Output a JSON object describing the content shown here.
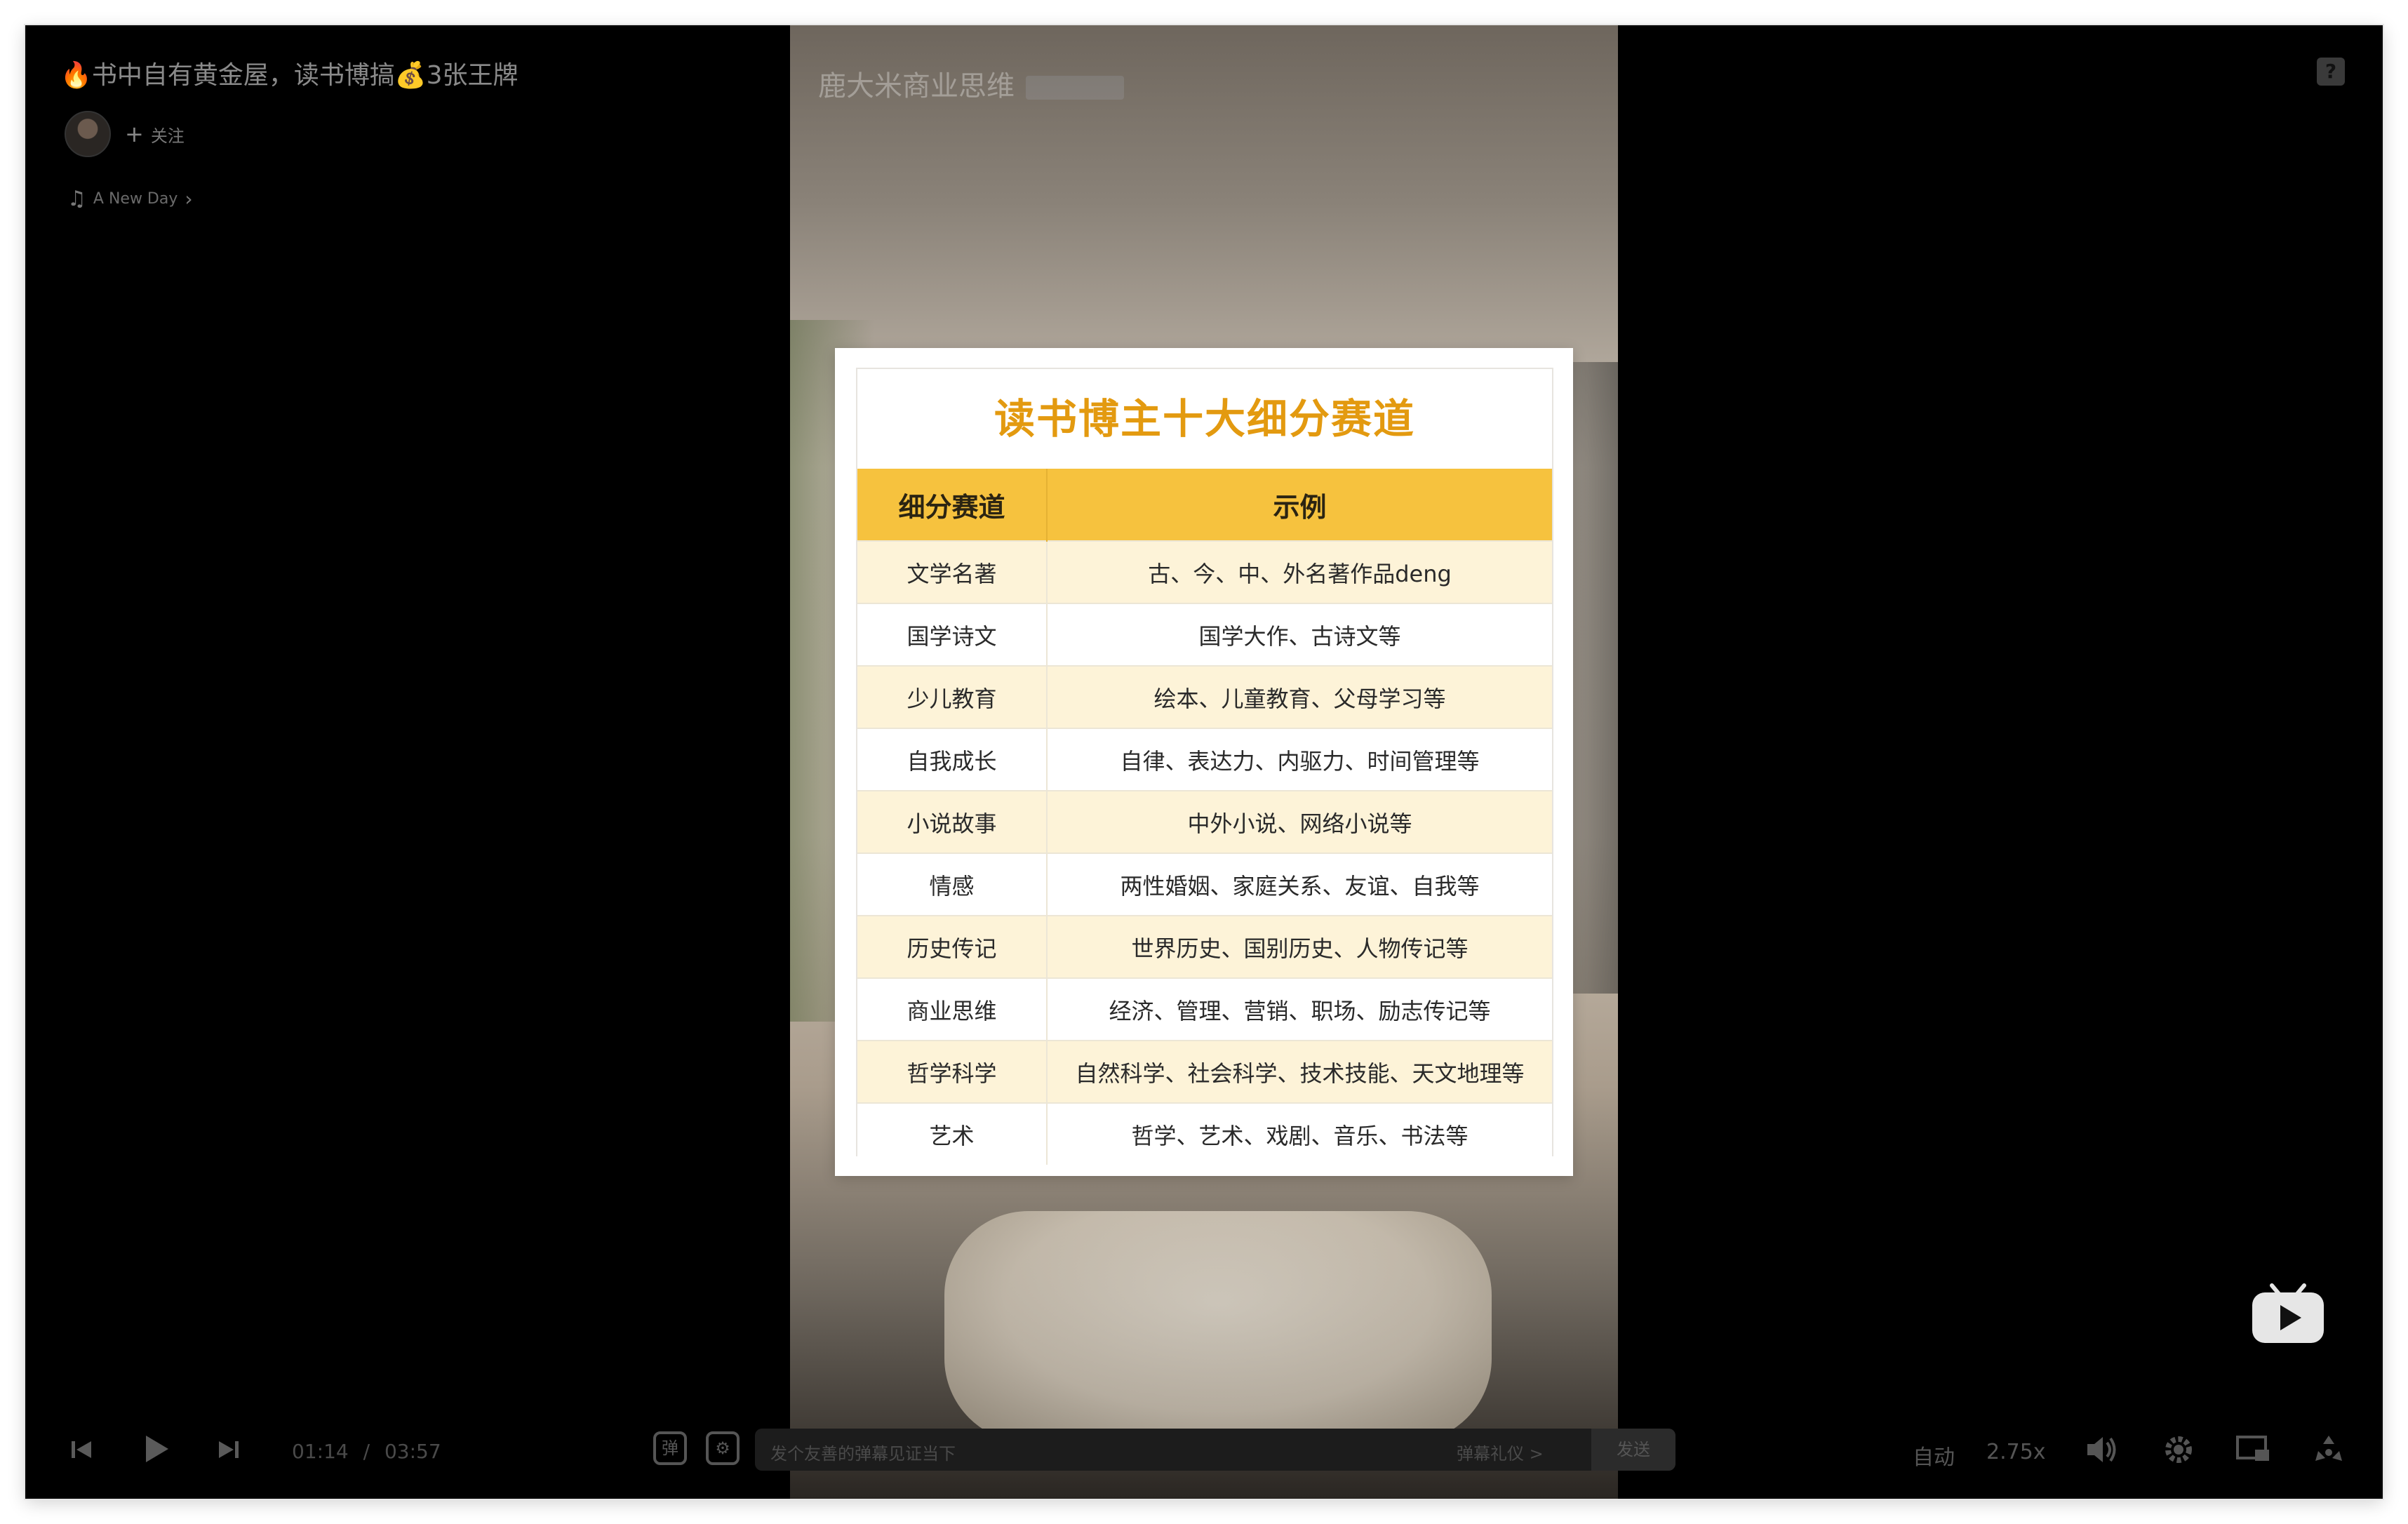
{
  "header": {
    "title": "🔥书中自有黄金屋，读书博搞💰3张王牌",
    "follow_label": "关注",
    "music_title": "A New Day",
    "help_icon": "question-icon"
  },
  "video": {
    "watermark": "鹿大米商业思维"
  },
  "card": {
    "title": "读书博主十大细分赛道",
    "columns": [
      "细分赛道",
      "示例"
    ],
    "rows": [
      [
        "文学名著",
        "古、今、中、外名著作品deng"
      ],
      [
        "国学诗文",
        "国学大作、古诗文等"
      ],
      [
        "少儿教育",
        "绘本、儿童教育、父母学习等"
      ],
      [
        "自我成长",
        "自律、表达力、内驱力、时间管理等"
      ],
      [
        "小说故事",
        "中外小说、网络小说等"
      ],
      [
        "情感",
        "两性婚姻、家庭关系、友谊、自我等"
      ],
      [
        "历史传记",
        "世界历史、国别历史、人物传记等"
      ],
      [
        "商业思维",
        "经济、管理、营销、职场、励志传记等"
      ],
      [
        "哲学科学",
        "自然科学、社会科学、技术技能、天文地理等"
      ],
      [
        "艺术",
        "哲学、艺术、戏剧、音乐、书法等"
      ]
    ]
  },
  "controls": {
    "current_time": "01:14",
    "separator": "/",
    "duration": "03:57",
    "quality_label": "自动",
    "speed_label": "2.75x",
    "danmaku_placeholder": "发个友善的弹幕见证当下",
    "danmaku_etiquette": "弹幕礼仪 >",
    "send_label": "发送"
  },
  "colors": {
    "accent": "#f6c23e",
    "card_title": "#e39a10",
    "row_tint": "#fdf3d8",
    "bilibili": "#fb7299"
  }
}
